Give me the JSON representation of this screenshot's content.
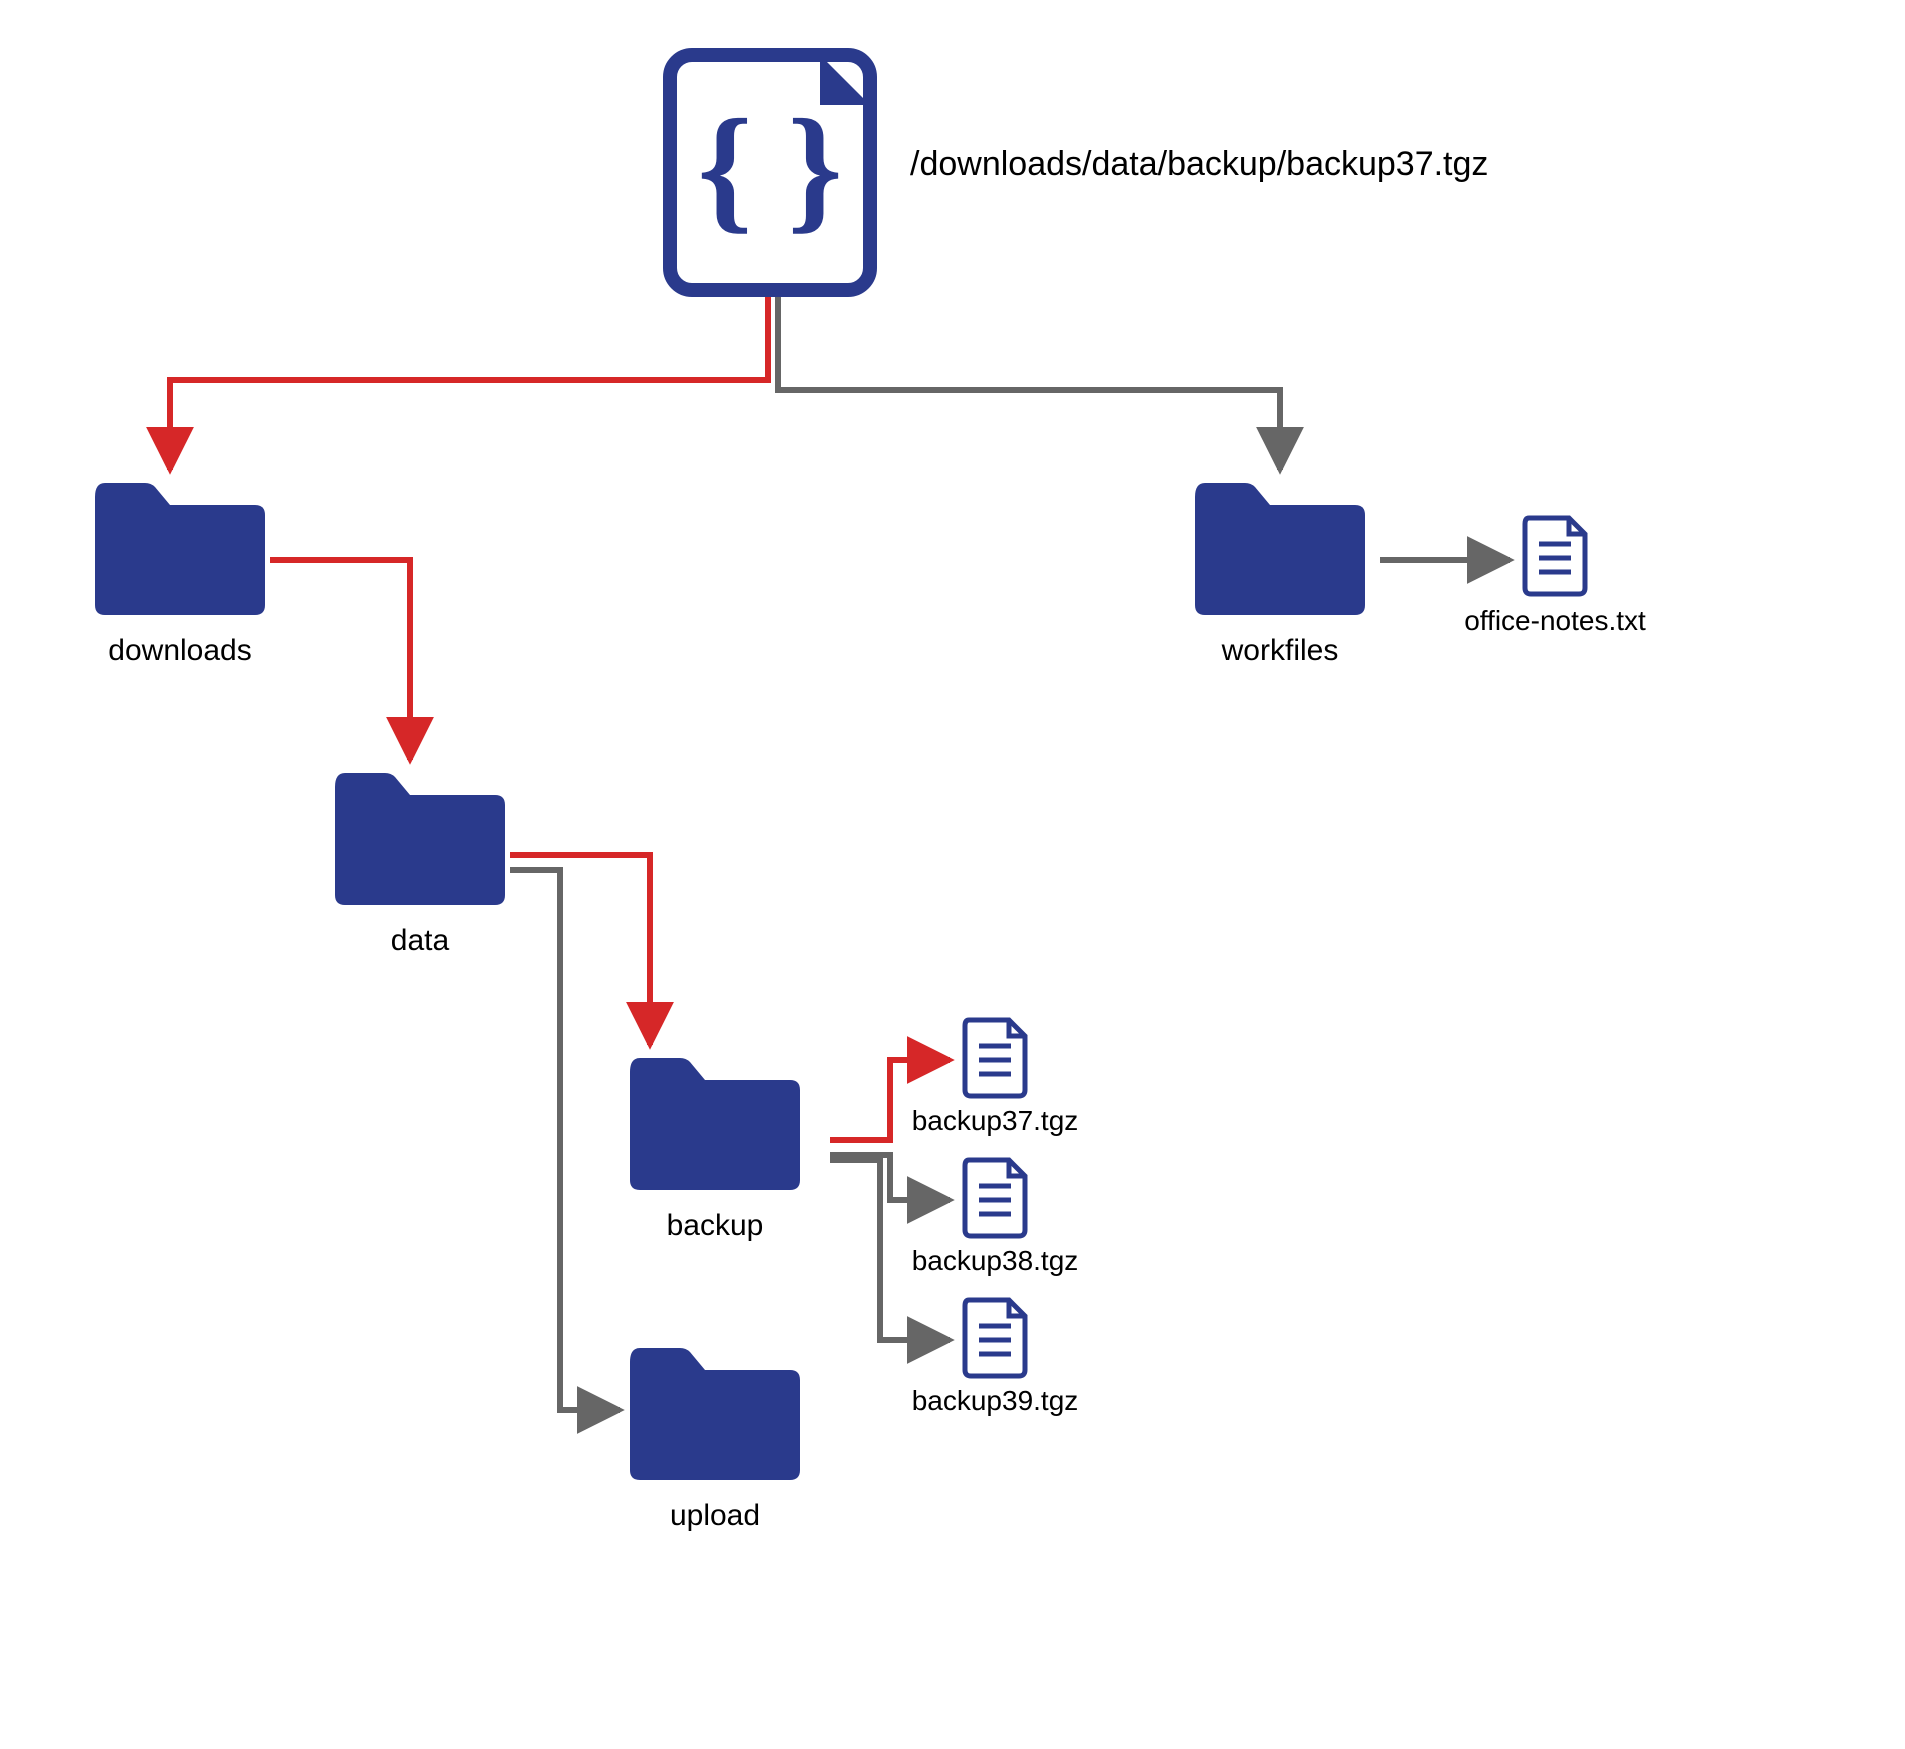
{
  "colors": {
    "folder": "#2a3a8c",
    "edgeGray": "#666666",
    "edgeRed": "#d62728",
    "iconStroke": "#2a3a8c",
    "white": "#ffffff"
  },
  "root": {
    "path_label": "/downloads/data/backup/backup37.tgz"
  },
  "folders": {
    "downloads": "downloads",
    "workfiles": "workfiles",
    "data": "data",
    "backup": "backup",
    "upload": "upload"
  },
  "files": {
    "office_notes": "office-notes.txt",
    "backup37": "backup37.tgz",
    "backup38": "backup38.tgz",
    "backup39": "backup39.tgz"
  }
}
